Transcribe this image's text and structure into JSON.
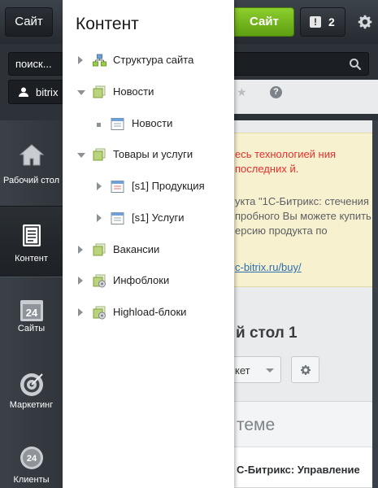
{
  "header": {
    "site_button_left": "Сайт",
    "site_button_green": "Сайт",
    "notifications_count": "2",
    "notify_icon_glyph": "!"
  },
  "search": {
    "value": "поиск..."
  },
  "user": {
    "name": "bitrix"
  },
  "sidebar": {
    "items": [
      {
        "label": "Рабочий стол",
        "icon": "house-icon"
      },
      {
        "label": "Контент",
        "icon": "document-icon"
      },
      {
        "label": "Сайты",
        "icon": "calendar-24-icon"
      },
      {
        "label": "Маркетинг",
        "icon": "target-icon"
      },
      {
        "label": "Клиенты",
        "icon": "clock-24-icon"
      }
    ],
    "calendar_number": "24",
    "clients_number": "24"
  },
  "panel": {
    "title": "Контент",
    "tree": [
      {
        "label": "Структура сайта",
        "icon": "site-structure-icon",
        "toggle": "collapsed"
      },
      {
        "label": "Новости",
        "icon": "section-icon",
        "toggle": "expanded"
      },
      {
        "label": "Новости",
        "icon": "list-icon",
        "toggle": "leaf"
      },
      {
        "label": "Товары и услуги",
        "icon": "section-icon",
        "toggle": "expanded"
      },
      {
        "label": "[s1] Продукция",
        "icon": "list-icon",
        "toggle": "collapsed"
      },
      {
        "label": "[s1] Услуги",
        "icon": "list-icon",
        "toggle": "collapsed"
      },
      {
        "label": "Вакансии",
        "icon": "section-icon",
        "toggle": "collapsed"
      },
      {
        "label": "Инфоблоки",
        "icon": "iblock-icon",
        "toggle": "collapsed"
      },
      {
        "label": "Highload-блоки",
        "icon": "iblock-icon",
        "toggle": "collapsed"
      }
    ]
  },
  "background": {
    "notice_red": "есь технологией ния последних й.",
    "notice_gray": "укта \"1С-Битрикс: стечения пробного Вы можете купить ерсию продукта по",
    "notice_link": "c-bitrix.ru/buy/",
    "desktop_title": "й стол 1",
    "select_value": "кет",
    "widget_title": "теме",
    "widget_text": "С-Битрикс: Управление"
  },
  "colors": {
    "accent_green": "#6cb21b",
    "notice_red": "#e8302d",
    "link_blue": "#2a6fb0",
    "dark_chrome": "#2a2f35"
  }
}
